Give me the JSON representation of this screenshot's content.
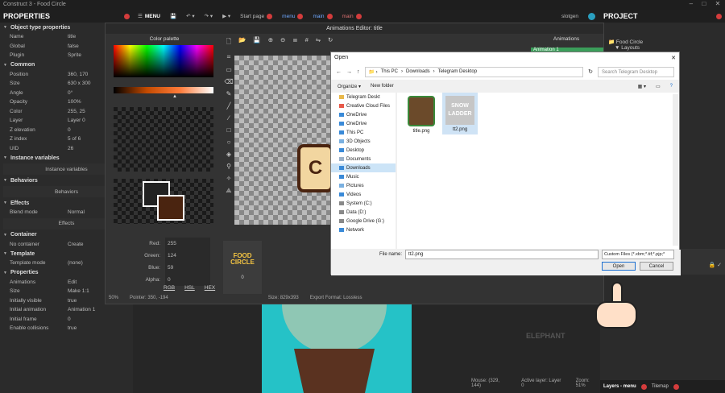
{
  "window": {
    "title": "Construct 3 - Food Circle"
  },
  "properties": {
    "title": "PROPERTIES",
    "sections": [
      {
        "label": "Object type properties",
        "rows": [
          {
            "k": "Name",
            "v": "title"
          },
          {
            "k": "Global",
            "v": "false"
          },
          {
            "k": "Plugin",
            "v": "Sprite"
          }
        ]
      },
      {
        "label": "Common",
        "rows": [
          {
            "k": "Position",
            "v": "360, 170"
          },
          {
            "k": "Size",
            "v": "630 x 300"
          },
          {
            "k": "Angle",
            "v": "0°"
          },
          {
            "k": "Opacity",
            "v": "100%"
          },
          {
            "k": "Color",
            "v": "255, 25"
          },
          {
            "k": "Layer",
            "v": "Layer 0"
          },
          {
            "k": "Z elevation",
            "v": "0"
          },
          {
            "k": "Z index",
            "v": "5 of 6"
          },
          {
            "k": "UID",
            "v": "26"
          }
        ]
      },
      {
        "label": "Instance variables",
        "button": "Instance variables"
      },
      {
        "label": "Behaviors",
        "button": "Behaviors"
      },
      {
        "label": "Effects",
        "rows": [
          {
            "k": "Blend mode",
            "v": "Normal"
          }
        ],
        "button": "Effects"
      },
      {
        "label": "Container",
        "rows": [
          {
            "k": "No container",
            "v": "Create"
          }
        ]
      },
      {
        "label": "Template",
        "rows": [
          {
            "k": "Template mode",
            "v": "(none)"
          }
        ]
      },
      {
        "label": "Properties",
        "rows": [
          {
            "k": "Animations",
            "v": "Edit"
          },
          {
            "k": "Size",
            "v": "Make 1:1"
          },
          {
            "k": "Initially visible",
            "v": "true"
          },
          {
            "k": "Initial animation",
            "v": "Animation 1"
          },
          {
            "k": "Initial frame",
            "v": "0"
          },
          {
            "k": "Enable collisions",
            "v": "true"
          }
        ]
      }
    ]
  },
  "toolbar": {
    "menu": "MENU",
    "tabs": [
      "Start page",
      "menu",
      "main",
      "main"
    ],
    "user": "slotgen"
  },
  "project": {
    "title": "PROJECT",
    "items": [
      "Food Circle",
      "Layouts"
    ],
    "footer": [
      "Layers - menu",
      "Tilemap"
    ]
  },
  "anim_editor": {
    "title": "Animations Editor: title",
    "palette_title": "Color palette",
    "animations_title": "Animations",
    "animation_item": "Animation 1",
    "rgba": [
      {
        "k": "Red:",
        "v": "255"
      },
      {
        "k": "Green:",
        "v": "124"
      },
      {
        "k": "Blue:",
        "v": "59"
      },
      {
        "k": "Alpha:",
        "v": "0"
      }
    ],
    "modes": [
      "RGB",
      "HSL",
      "HEX"
    ],
    "frame_label": "0",
    "frame_text": [
      "FOOD",
      "CIRCLE"
    ],
    "status": {
      "zoom": "50%",
      "pointer": "Pointer: 350, -194",
      "size": "Size: 829x393",
      "export": "Export Format: Lossless"
    },
    "colors": {
      "primary": "#ffffff",
      "secondary": "#4a2410"
    }
  },
  "dialog": {
    "title": "Open",
    "path": [
      "This PC",
      "Downloads",
      "Telegram Desktop"
    ],
    "search_placeholder": "Search Telegram Desktop",
    "organize": "Organize ▾",
    "new_folder": "New folder",
    "tree": [
      "Telegram Deskt",
      "Creative Cloud Files",
      "OneDrive",
      "OneDrive",
      "This PC",
      "3D Objects",
      "Desktop",
      "Documents",
      "Downloads",
      "Music",
      "Pictures",
      "Videos",
      "System (C:)",
      "Data (D:)",
      "Google Drive (G:)",
      "Network"
    ],
    "files": [
      {
        "name": "title.png"
      },
      {
        "name": "tt2.png"
      }
    ],
    "file_name_label": "File name:",
    "file_name": "tt2.png",
    "filter": "Custom Files (*.xbm;*.tif;*.pjp;*",
    "open": "Open",
    "cancel": "Cancel"
  },
  "layout": {
    "mouse": "Mouse: (329, 144)",
    "active_layer": "Active layer: Layer 0",
    "zoom": "Zoom: 51%",
    "watermark": "ELEPHANT"
  }
}
